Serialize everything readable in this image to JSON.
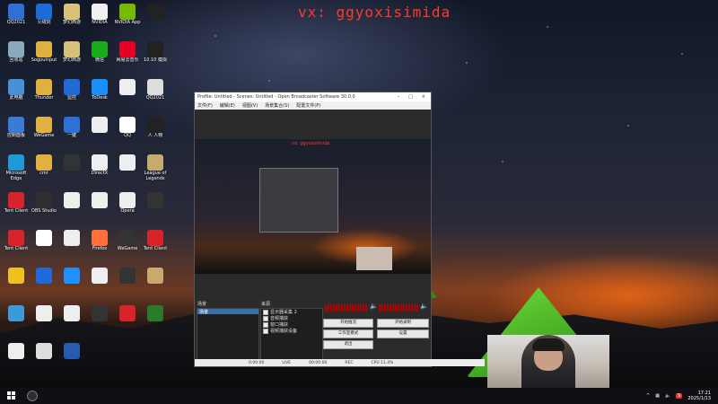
{
  "watermark": "vx: ggyoxisimida",
  "desktop_icons": [
    {
      "label": "QQ2021",
      "color": "#2f6fd6"
    },
    {
      "label": "火绒剑",
      "color": "#1e6bd7"
    },
    {
      "label": "梦幻西游",
      "color": "#d8c27a"
    },
    {
      "label": "NVIDIA",
      "color": "#f0f0f0"
    },
    {
      "label": "NVIDIA App",
      "color": "#76b900"
    },
    {
      "label": "",
      "color": "#222"
    },
    {
      "label": "回收站",
      "color": "#8ab"
    },
    {
      "label": "Sogoulnput",
      "color": "#e0b040"
    },
    {
      "label": "梦幻西游",
      "color": "#d8c27a"
    },
    {
      "label": "微信",
      "color": "#1aad19"
    },
    {
      "label": "网易云音乐",
      "color": "#e60026"
    },
    {
      "label": "10.10 模拟",
      "color": "#222"
    },
    {
      "label": "此电脑",
      "color": "#4a90d9"
    },
    {
      "label": "Thunder",
      "color": "#e0b040"
    },
    {
      "label": "监控",
      "color": "#1e6bd7"
    },
    {
      "label": "ToDesk",
      "color": "#1a8ffb"
    },
    {
      "label": "",
      "color": "#eee"
    },
    {
      "label": "QQ2021",
      "color": "#ddd"
    },
    {
      "label": "控制面板",
      "color": "#3a7bd5"
    },
    {
      "label": "WeGame",
      "color": "#e0b040"
    },
    {
      "label": "一键",
      "color": "#2f6fd6"
    },
    {
      "label": "",
      "color": "#eee"
    },
    {
      "label": "QQ",
      "color": "#fff"
    },
    {
      "label": "人 人物",
      "color": "#222"
    },
    {
      "label": "Microsoft Edge",
      "color": "#1c9ad6"
    },
    {
      "label": "cmr",
      "color": "#e0b040"
    },
    {
      "label": "",
      "color": "#333"
    },
    {
      "label": "DirectX",
      "color": "#eee"
    },
    {
      "label": "",
      "color": "#eee"
    },
    {
      "label": "League of Legends",
      "color": "#c8aa6e"
    },
    {
      "label": "Tent Client",
      "color": "#d8232a"
    },
    {
      "label": "OBS Studio",
      "color": "#302e31"
    },
    {
      "label": "",
      "color": "#eee"
    },
    {
      "label": "",
      "color": "#eee"
    },
    {
      "label": "Opera",
      "color": "#eee"
    },
    {
      "label": "",
      "color": "#333"
    },
    {
      "label": "Tent Client",
      "color": "#d8232a"
    },
    {
      "label": "",
      "color": "#fff"
    },
    {
      "label": "",
      "color": "#eee"
    },
    {
      "label": "Firefox",
      "color": "#ff7139"
    },
    {
      "label": "WeGame",
      "color": "#333"
    },
    {
      "label": "Tent Client",
      "color": "#d8232a"
    },
    {
      "label": "",
      "color": "#f0c020"
    },
    {
      "label": "",
      "color": "#1e6bd7"
    },
    {
      "label": "",
      "color": "#1e90ff"
    },
    {
      "label": "",
      "color": "#eee"
    },
    {
      "label": "",
      "color": "#333"
    },
    {
      "label": "",
      "color": "#c8aa6e"
    },
    {
      "label": "",
      "color": "#3a9bd9"
    },
    {
      "label": "",
      "color": "#eee"
    },
    {
      "label": "",
      "color": "#eee"
    },
    {
      "label": "",
      "color": "#333"
    },
    {
      "label": "",
      "color": "#d8232a"
    },
    {
      "label": "",
      "color": "#2a7a2a"
    },
    {
      "label": "",
      "color": "#eee"
    },
    {
      "label": "",
      "color": "#ddd"
    },
    {
      "label": "",
      "color": "#2a5ab0"
    }
  ],
  "obs": {
    "title": "Profile: Untitled - Scenes: Untitled - Open Broadcaster Software 30.0.0",
    "menu": [
      "文件(F)",
      "编辑(E)",
      "视图(V)",
      "场景集合(S)",
      "配置文件(P)"
    ],
    "preview_watermark": "vx: ggyoxisimida",
    "scenes_label": "场景",
    "sources_label": "来源",
    "scene_item": "场景",
    "sources": [
      "显示器采集 2",
      "音频捕获",
      "窗口捕获",
      "视频捕获设备"
    ],
    "buttons": [
      "开始推流",
      "开始录制",
      "工作室模式",
      "设置",
      "退出"
    ],
    "status": [
      "0:00:00",
      "LIVE",
      "00:00:00",
      "REC",
      "CPU 11.4%"
    ]
  },
  "taskbar": {
    "time": "17:21",
    "date": "2025/1/13"
  }
}
